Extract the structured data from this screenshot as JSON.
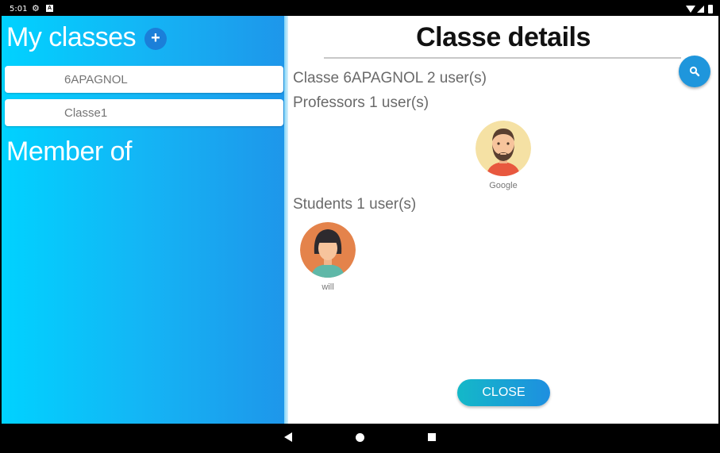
{
  "status_bar": {
    "time": "5:01",
    "icons": [
      "gear-icon",
      "a-icon",
      "wifi-icon",
      "signal-icon",
      "battery-icon"
    ]
  },
  "sidebar": {
    "my_classes_heading": "My classes",
    "add_class_icon": "+",
    "classes": [
      {
        "name": "6APAGNOL"
      },
      {
        "name": "Classe1"
      }
    ],
    "member_of_heading": "Member of"
  },
  "details": {
    "title": "Classe details",
    "class_info": "Classe 6APAGNOL 2 user(s)",
    "professors_info": "Professors 1 user(s)",
    "professors": [
      {
        "name": "Google",
        "avatar": "bearded-man-avatar"
      }
    ],
    "students_info": "Students 1 user(s)",
    "students": [
      {
        "name": "will",
        "avatar": "woman-avatar"
      }
    ],
    "close_label": "CLOSE"
  },
  "colors": {
    "sidebar_gradient_start": "#00d2ff",
    "sidebar_gradient_end": "#1e96ea",
    "search_button": "#1f96dc",
    "close_gradient_start": "#14b8c8",
    "close_gradient_end": "#1e8fe0"
  }
}
